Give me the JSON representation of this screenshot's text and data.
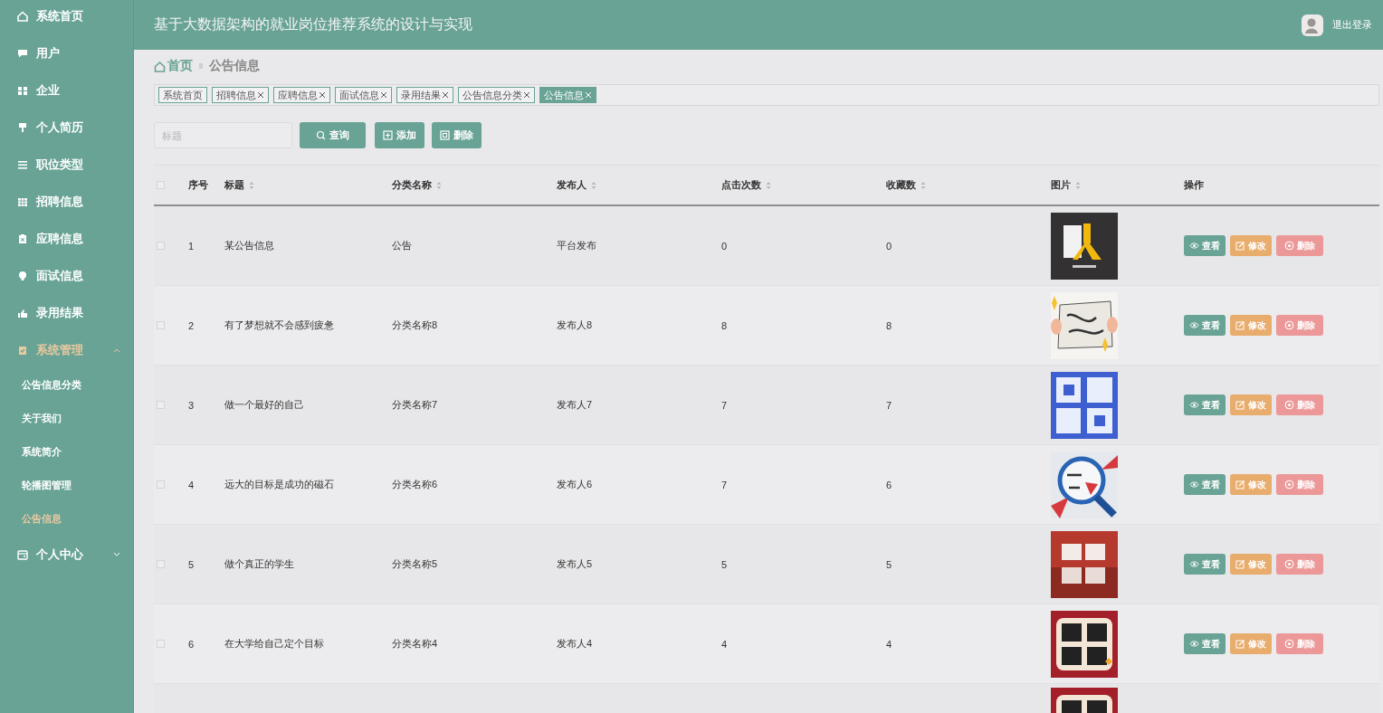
{
  "sidebar": {
    "items": [
      {
        "label": "系统首页",
        "selected": false
      },
      {
        "label": "用户",
        "selected": false
      },
      {
        "label": "企业",
        "selected": false
      },
      {
        "label": "个人简历",
        "selected": false
      },
      {
        "label": "职位类型",
        "selected": false
      },
      {
        "label": "招聘信息",
        "selected": false
      },
      {
        "label": "应聘信息",
        "selected": false
      },
      {
        "label": "面试信息",
        "selected": false
      },
      {
        "label": "录用结果",
        "selected": false
      },
      {
        "label": "系统管理",
        "selected": true,
        "expanded": true,
        "children": [
          {
            "label": "公告信息分类",
            "selected": false
          },
          {
            "label": "关于我们",
            "selected": false
          },
          {
            "label": "系统简介",
            "selected": false
          },
          {
            "label": "轮播图管理",
            "selected": false
          },
          {
            "label": "公告信息",
            "selected": true
          }
        ]
      },
      {
        "label": "个人中心",
        "selected": false,
        "expanded": false
      }
    ]
  },
  "header": {
    "title": "基于大数据架构的就业岗位推荐系统的设计与实现",
    "logout": "退出登录"
  },
  "breadcrumb": {
    "home": "首页",
    "current": "公告信息"
  },
  "tabs": [
    {
      "label": "系统首页",
      "closable": false,
      "selected": false
    },
    {
      "label": "招聘信息",
      "closable": true,
      "selected": false
    },
    {
      "label": "应聘信息",
      "closable": true,
      "selected": false
    },
    {
      "label": "面试信息",
      "closable": true,
      "selected": false
    },
    {
      "label": "录用结果",
      "closable": true,
      "selected": false
    },
    {
      "label": "公告信息分类",
      "closable": true,
      "selected": false
    },
    {
      "label": "公告信息",
      "closable": true,
      "selected": true
    }
  ],
  "toolbar": {
    "search": {
      "placeholder": "标题"
    },
    "buttons": [
      {
        "label": "查询",
        "kind": "search"
      },
      {
        "label": "添加",
        "kind": "add"
      },
      {
        "label": "删除",
        "kind": "delete"
      }
    ]
  },
  "table": {
    "select_all_checked": false,
    "columns": [
      {
        "label": "序号",
        "sortable": false
      },
      {
        "label": "标题",
        "sortable": true
      },
      {
        "label": "分类名称",
        "sortable": true
      },
      {
        "label": "发布人",
        "sortable": true
      },
      {
        "label": "点击次数",
        "sortable": true
      },
      {
        "label": "收藏数",
        "sortable": true
      },
      {
        "label": "图片",
        "sortable": true
      },
      {
        "label": "操作",
        "sortable": false
      }
    ],
    "rows": [
      {
        "checked": false,
        "cells": [
          "1",
          "某公告信息",
          "公告",
          "平台发布",
          "0",
          "0"
        ],
        "picture": {
          "kind": "picture"
        },
        "actions": [
          {
            "label": "查看",
            "kind": "view"
          },
          {
            "label": "修改",
            "kind": "edit"
          },
          {
            "label": "删除",
            "kind": "delete"
          }
        ]
      },
      {
        "checked": false,
        "cells": [
          "2",
          "有了梦想就不会感到疲惫",
          "分类名称8",
          "发布人8",
          "8",
          "8"
        ],
        "picture": {
          "kind": "picture"
        },
        "actions": [
          {
            "label": "查看",
            "kind": "view"
          },
          {
            "label": "修改",
            "kind": "edit"
          },
          {
            "label": "删除",
            "kind": "delete"
          }
        ]
      },
      {
        "checked": false,
        "cells": [
          "3",
          "做一个最好的自己",
          "分类名称7",
          "发布人7",
          "7",
          "7"
        ],
        "picture": {
          "kind": "picture"
        },
        "actions": [
          {
            "label": "查看",
            "kind": "view"
          },
          {
            "label": "修改",
            "kind": "edit"
          },
          {
            "label": "删除",
            "kind": "delete"
          }
        ]
      },
      {
        "checked": false,
        "cells": [
          "4",
          "远大的目标是成功的磁石",
          "分类名称6",
          "发布人6",
          "7",
          "6"
        ],
        "picture": {
          "kind": "picture"
        },
        "actions": [
          {
            "label": "查看",
            "kind": "view"
          },
          {
            "label": "修改",
            "kind": "edit"
          },
          {
            "label": "删除",
            "kind": "delete"
          }
        ]
      },
      {
        "checked": false,
        "cells": [
          "5",
          "做个真正的学生",
          "分类名称5",
          "发布人5",
          "5",
          "5"
        ],
        "picture": {
          "kind": "picture"
        },
        "actions": [
          {
            "label": "查看",
            "kind": "view"
          },
          {
            "label": "修改",
            "kind": "edit"
          },
          {
            "label": "删除",
            "kind": "delete"
          }
        ]
      },
      {
        "checked": false,
        "cells": [
          "6",
          "在大学给自己定个目标",
          "分类名称4",
          "发布人4",
          "4",
          "4"
        ],
        "picture": {
          "kind": "picture"
        },
        "actions": [
          {
            "label": "查看",
            "kind": "view"
          },
          {
            "label": "修改",
            "kind": "edit"
          },
          {
            "label": "删除",
            "kind": "delete"
          }
        ]
      }
    ],
    "partial_row": {
      "picture": {
        "kind": "picture"
      }
    }
  }
}
